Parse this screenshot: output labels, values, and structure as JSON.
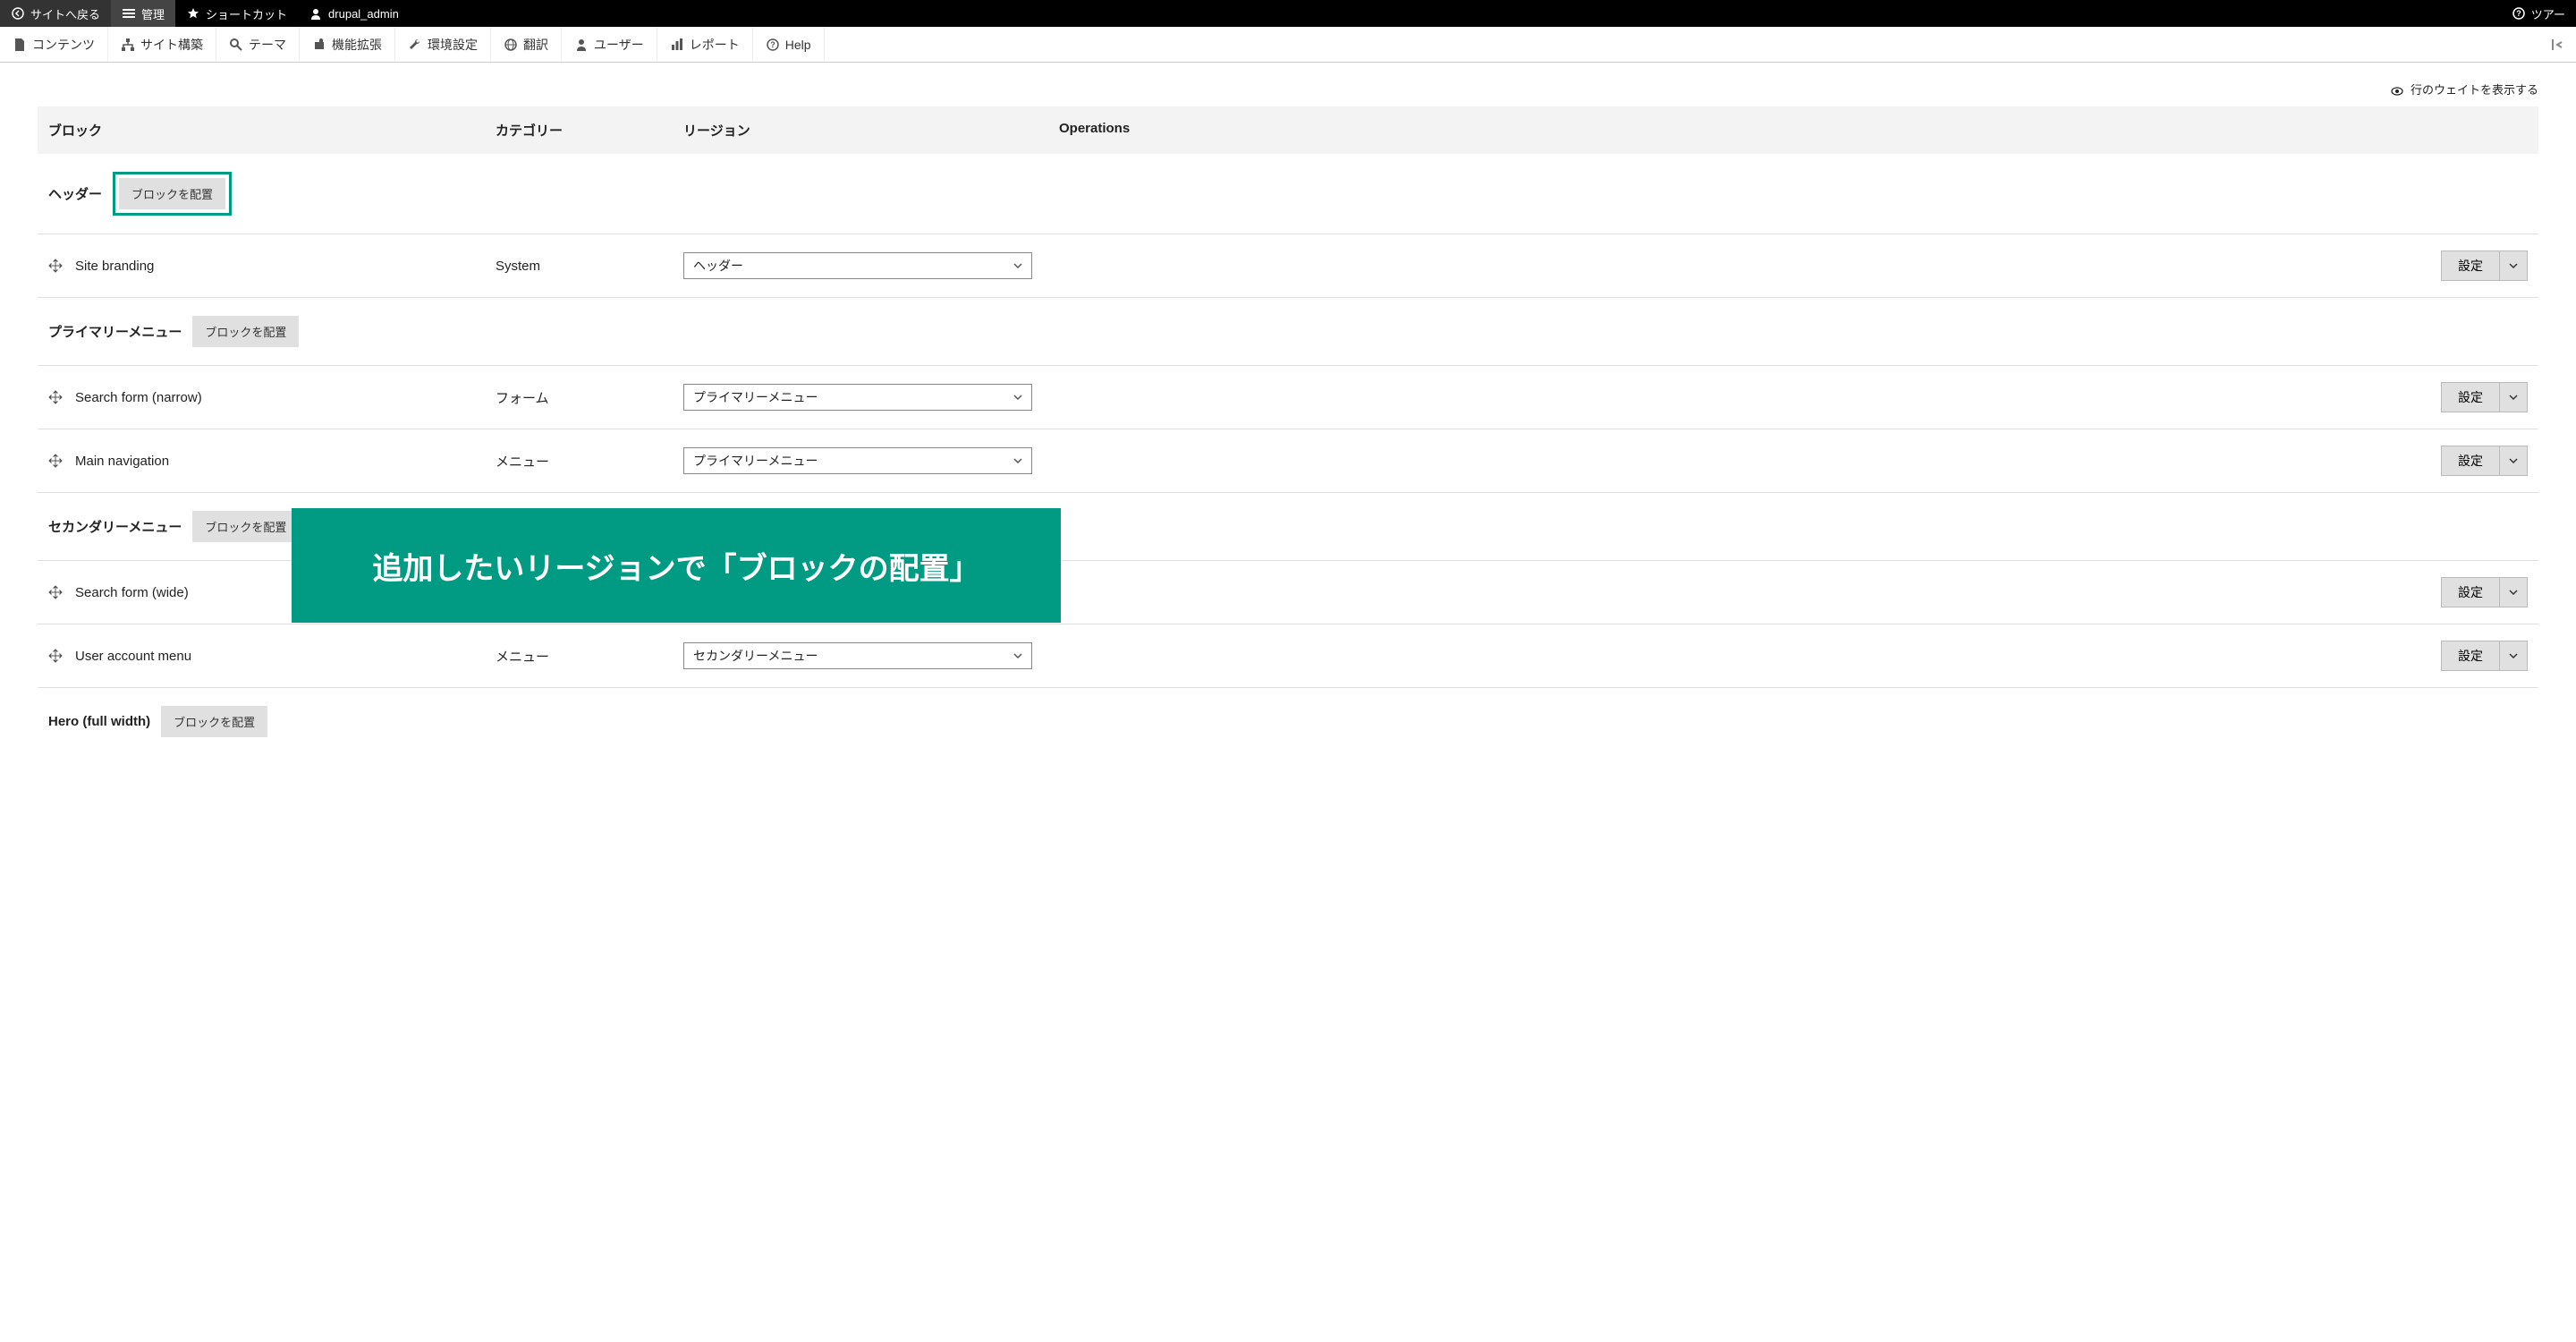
{
  "topbar": {
    "back": "サイトへ戻る",
    "manage": "管理",
    "shortcuts": "ショートカット",
    "user": "drupal_admin",
    "tour": "ツアー"
  },
  "adminbar": {
    "content": "コンテンツ",
    "structure": "サイト構築",
    "appearance": "テーマ",
    "extend": "機能拡張",
    "config": "環境設定",
    "translate": "翻訳",
    "people": "ユーザー",
    "reports": "レポート",
    "help": "Help"
  },
  "show_weights": "行のウェイトを表示する",
  "headers": {
    "block": "ブロック",
    "category": "カテゴリー",
    "region": "リージョン",
    "operations": "Operations"
  },
  "regions": [
    {
      "name": "ヘッダー",
      "place": "ブロックを配置",
      "highlighted": true
    },
    {
      "name": "プライマリーメニュー",
      "place": "ブロックを配置",
      "highlighted": false
    },
    {
      "name": "セカンダリーメニュー",
      "place": "ブロックを配置",
      "highlighted": false
    },
    {
      "name": "Hero (full width)",
      "place": "ブロックを配置",
      "highlighted": false
    }
  ],
  "blocks": [
    {
      "name": "Site branding",
      "category": "System",
      "region": "ヘッダー",
      "op": "設定"
    },
    {
      "name": "Search form (narrow)",
      "category": "フォーム",
      "region": "プライマリーメニュー",
      "op": "設定"
    },
    {
      "name": "Main navigation",
      "category": "メニュー",
      "region": "プライマリーメニュー",
      "op": "設定"
    },
    {
      "name": "Search form (wide)",
      "category": "",
      "region": "",
      "op": "設定"
    },
    {
      "name": "User account menu",
      "category": "メニュー",
      "region": "セカンダリーメニュー",
      "op": "設定"
    }
  ],
  "overlay_text": "追加したいリージョンで「ブロックの配置」"
}
